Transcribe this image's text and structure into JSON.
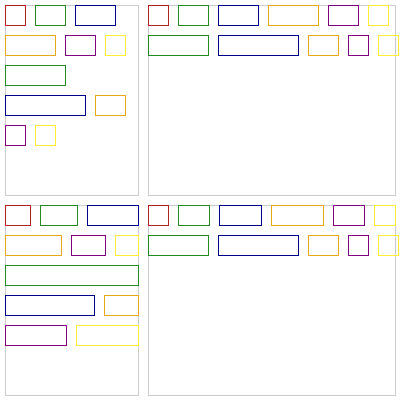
{
  "colors": {
    "red": "#b22222",
    "green": "#228b22",
    "blue": "#00008b",
    "orange": "#e6a817",
    "purple": "#800080",
    "yellow": "#ffee33",
    "panel_border": "#cccccc"
  },
  "panels": [
    {
      "name": "panel-top-left"
    },
    {
      "name": "panel-top-right"
    },
    {
      "name": "panel-bottom-left"
    },
    {
      "name": "panel-bottom-right"
    }
  ]
}
